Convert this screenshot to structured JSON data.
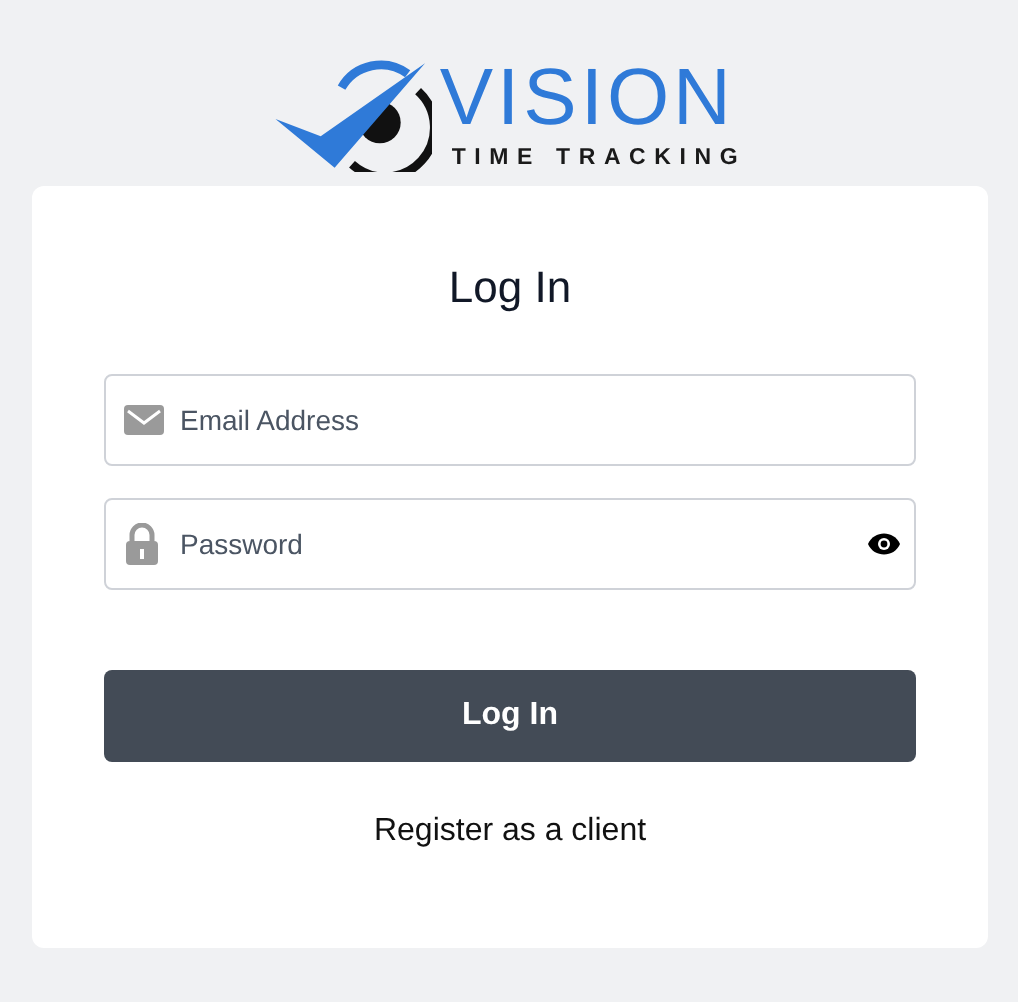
{
  "logo": {
    "name": "VISION",
    "tagline": "TIME TRACKING"
  },
  "form": {
    "title": "Log In",
    "fields": [
      {
        "kind": "email",
        "placeholder": "Email Address"
      },
      {
        "kind": "password",
        "placeholder": "Password"
      }
    ],
    "submit": "Log In",
    "link": "Register as a client"
  }
}
